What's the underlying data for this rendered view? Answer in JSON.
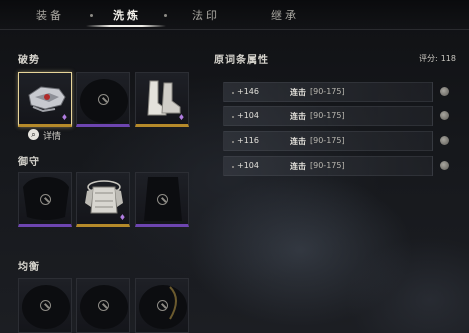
{
  "tabs": [
    {
      "label": "装备"
    },
    {
      "label": "洗炼"
    },
    {
      "label": "法印"
    },
    {
      "label": "继承"
    }
  ],
  "sections": {
    "pojing": "破势",
    "yushou": "御守",
    "junheng": "均衡"
  },
  "detail_label": "详情",
  "panel": {
    "title": "原词条属性",
    "score_label": "评分:",
    "score_value": "118"
  },
  "attributes": [
    {
      "value": "+146",
      "name": "连击",
      "range": "[90-175]"
    },
    {
      "value": "+104",
      "name": "连击",
      "range": "[90-175]"
    },
    {
      "value": "+116",
      "name": "连击",
      "range": "[90-175]"
    },
    {
      "value": "+104",
      "name": "连击",
      "range": "[90-175]"
    }
  ],
  "colors": {
    "gold_rarity": "#b58a2a",
    "purple_rarity": "#6d45b0",
    "selected_border": "#e8d59a"
  },
  "icons": {
    "empty_slot": "ban-icon",
    "flame": "flame-icon",
    "search": "search-icon",
    "lock": "lock-icon"
  }
}
